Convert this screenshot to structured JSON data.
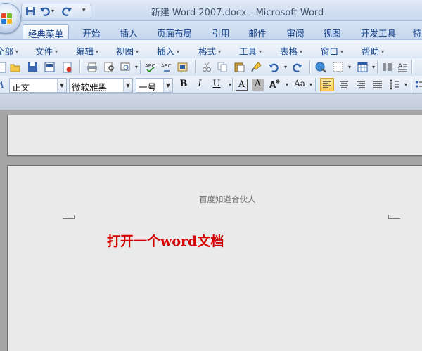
{
  "window": {
    "title": "新建 Word 2007.docx - Microsoft Word"
  },
  "ribbon_tabs": [
    {
      "label": "经典菜单",
      "active": true
    },
    {
      "label": "开始"
    },
    {
      "label": "插入"
    },
    {
      "label": "页面布局"
    },
    {
      "label": "引用"
    },
    {
      "label": "邮件"
    },
    {
      "label": "审阅"
    },
    {
      "label": "视图"
    },
    {
      "label": "开发工具"
    },
    {
      "label": "特"
    }
  ],
  "menus": [
    "全部",
    "文件",
    "编辑",
    "视图",
    "插入",
    "格式",
    "工具",
    "表格",
    "窗口",
    "帮助"
  ],
  "format_bar": {
    "style": "正文",
    "font": "微软雅黑",
    "size": "一号",
    "bold": "B",
    "italic": "I",
    "underline": "U",
    "char_border": "A",
    "char_shading": "A",
    "change_case": "Aa"
  },
  "document": {
    "header": "百度知道合伙人",
    "body": "打开一个word文档"
  },
  "colors": {
    "body_text": "#d40000",
    "accent": "#15428b"
  }
}
